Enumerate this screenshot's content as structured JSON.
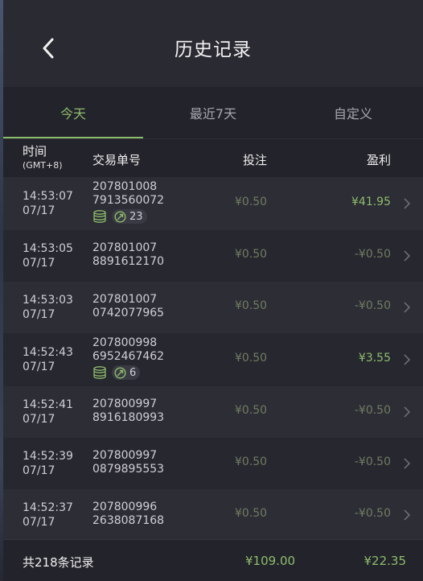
{
  "header": {
    "title": "历史记录",
    "back_icon": "chevron-left-icon"
  },
  "tabs": [
    {
      "label": "今天",
      "active": true
    },
    {
      "label": "最近7天",
      "active": false
    },
    {
      "label": "自定义",
      "active": false
    }
  ],
  "columns": {
    "time": "时间",
    "timezone": "(GMT+8)",
    "order": "交易单号",
    "bet": "投注",
    "profit": "盈利"
  },
  "colors": {
    "accent": "#8dbd6a",
    "muted_green": "#6f7d5f",
    "background": "#2a2a33"
  },
  "rows": [
    {
      "time": "14:53:07",
      "date": "07/17",
      "order_1": "207801008",
      "order_2": "7913560072",
      "bet": "¥0.50",
      "profit": "¥41.95",
      "profit_positive": true,
      "free_spins": "23"
    },
    {
      "time": "14:53:05",
      "date": "07/17",
      "order_1": "207801007",
      "order_2": "8891612170",
      "bet": "¥0.50",
      "profit": "-¥0.50",
      "profit_positive": false
    },
    {
      "time": "14:53:03",
      "date": "07/17",
      "order_1": "207801007",
      "order_2": "0742077965",
      "bet": "¥0.50",
      "profit": "-¥0.50",
      "profit_positive": false
    },
    {
      "time": "14:52:43",
      "date": "07/17",
      "order_1": "207800998",
      "order_2": "6952467462",
      "bet": "¥0.50",
      "profit": "¥3.55",
      "profit_positive": true,
      "free_spins": "6"
    },
    {
      "time": "14:52:41",
      "date": "07/17",
      "order_1": "207800997",
      "order_2": "8916180993",
      "bet": "¥0.50",
      "profit": "-¥0.50",
      "profit_positive": false
    },
    {
      "time": "14:52:39",
      "date": "07/17",
      "order_1": "207800997",
      "order_2": "0879895553",
      "bet": "¥0.50",
      "profit": "-¥0.50",
      "profit_positive": false
    },
    {
      "time": "14:52:37",
      "date": "07/17",
      "order_1": "207800996",
      "order_2": "2638087168",
      "bet": "¥0.50",
      "profit": "-¥0.50",
      "profit_positive": false
    }
  ],
  "footer": {
    "total": "共218条记录",
    "bet_total": "¥109.00",
    "profit_total": "¥22.35"
  }
}
